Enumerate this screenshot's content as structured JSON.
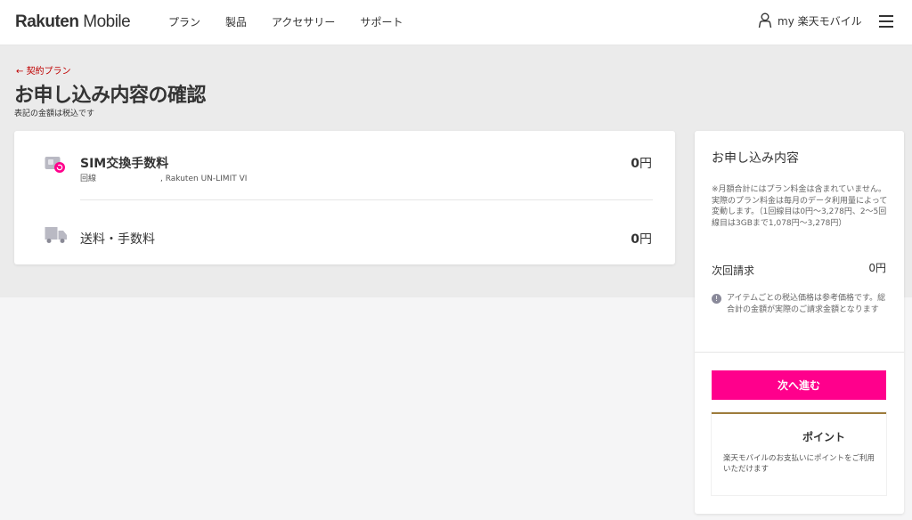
{
  "header": {
    "logo_bold": "Rakuten",
    "logo_light": " Mobile",
    "nav": [
      "プラン",
      "製品",
      "アクセサリー",
      "サポート"
    ],
    "account_label": "my 楽天モバイル",
    "user_icon": "user-icon",
    "menu_icon": "hamburger-menu-icon"
  },
  "page": {
    "back_link": "契約プラン",
    "title": "お申し込み内容の確認",
    "tax_note": "表記の金額は税込です"
  },
  "items": {
    "sim": {
      "icon": "sim-card-icon",
      "title": "SIM交換手数料",
      "subtitle": "回線　　　　　　　　, Rakuten UN-LIMIT VI",
      "price_value": "0",
      "price_unit": "円"
    },
    "shipping": {
      "icon": "truck-icon",
      "title": "送料・手数料",
      "price_value": "0",
      "price_unit": "円"
    }
  },
  "summary": {
    "title": "お申し込み内容",
    "note": "※月額合計にはプラン料金は含まれていません。実際のプラン料金は毎月のデータ利用量によって変動します。（1回線目は0円〜3,278円、2〜5回線目は3GBまで1,078円〜3,278円）",
    "next_billing_label": "次回請求",
    "next_billing_value": "0円",
    "info_note": "アイテムごとの税込価格は参考価格です。総合計の金額が実際のご請求金額となります",
    "proceed_button": "次へ進む",
    "points_title": "ポイント",
    "points_text": "楽天モバイルのお支払いにポイントをご利用いただけます"
  },
  "colors": {
    "accent": "#ff008c",
    "link": "#bf0000",
    "points_border": "#9e7c3c"
  }
}
